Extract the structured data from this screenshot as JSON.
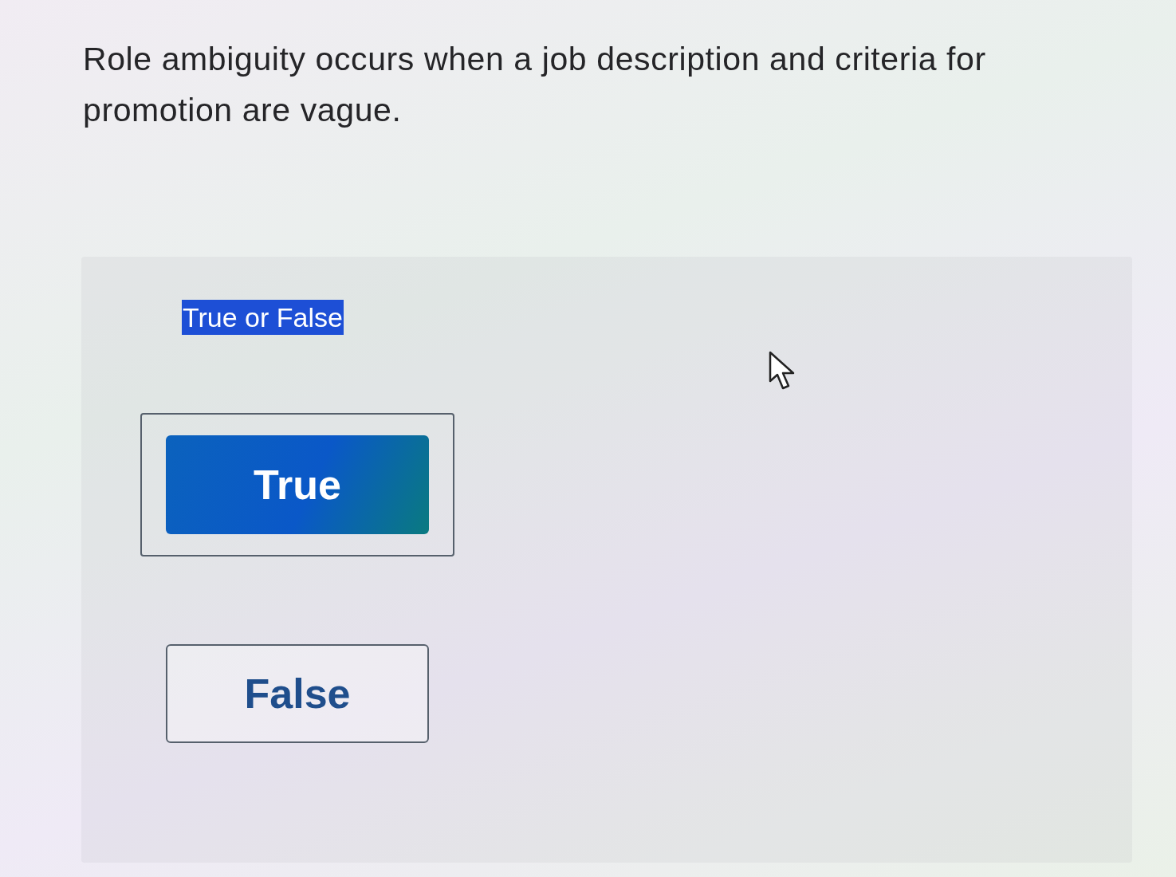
{
  "question": {
    "text": "Role ambiguity occurs when a job description and criteria for promotion are vague."
  },
  "answer_panel": {
    "prompt": {
      "text": "True or False",
      "highlighted": true
    },
    "options": [
      {
        "label": "True",
        "selected": true
      },
      {
        "label": "False",
        "selected": false
      }
    ]
  }
}
